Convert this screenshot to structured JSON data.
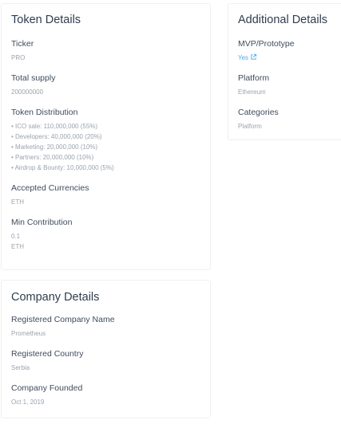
{
  "token_details": {
    "title": "Token Details",
    "ticker_label": "Ticker",
    "ticker_value": "PRO",
    "total_supply_label": "Total supply",
    "total_supply_value": "200000000",
    "distribution_label": "Token Distribution",
    "distribution_items": [
      "• ICO sale: 110,000,000 (55%)",
      "• Developers: 40,000,000 (20%)",
      "• Marketing: 20,000,000 (10%)",
      "• Partners: 20,000,000 (10%)",
      "• Airdrop & Bounty: 10,000,000 (5%)"
    ],
    "accepted_label": "Accepted Currencies",
    "accepted_value": "ETH",
    "min_contribution_label": "Min Contribution",
    "min_contribution_amount": "0.1",
    "min_contribution_currency": "ETH"
  },
  "additional_details": {
    "title": "Additional Details",
    "mvp_label": "MVP/Prototype",
    "mvp_value": "Yes",
    "mvp_icon": "external-link-icon",
    "platform_label": "Platform",
    "platform_value": "Ethereum",
    "categories_label": "Categories",
    "categories_value": "Platform"
  },
  "company_details": {
    "title": "Company Details",
    "name_label": "Registered Company Name",
    "name_value": "Prometheus",
    "country_label": "Registered Country",
    "country_value": "Serbia",
    "founded_label": "Company Founded",
    "founded_value": "Oct 1, 2019"
  },
  "colors": {
    "link": "#4aa8e6",
    "muted_text": "#9aa3ad",
    "heading_text": "#2f3d4d",
    "card_border": "#eef0f3"
  }
}
